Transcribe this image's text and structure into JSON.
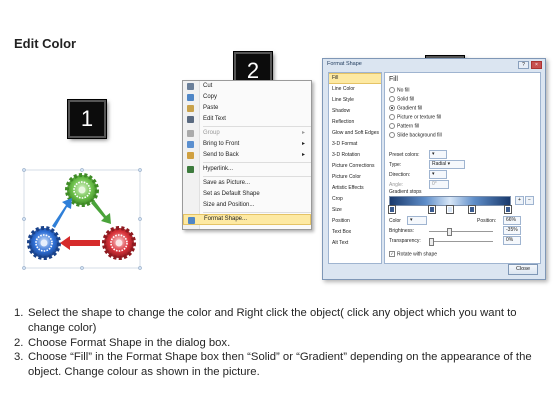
{
  "title": "Edit Color",
  "badges": [
    "1",
    "2",
    "3"
  ],
  "context_menu": {
    "items": [
      {
        "label": "Cut",
        "icon": "scissors-icon",
        "disabled": false,
        "submenu": false
      },
      {
        "label": "Copy",
        "icon": "copy-icon",
        "disabled": false,
        "submenu": false
      },
      {
        "label": "Paste",
        "icon": "paste-icon",
        "disabled": false,
        "submenu": false
      },
      {
        "label": "Edit Text",
        "icon": "edit-text-icon",
        "disabled": false,
        "submenu": false
      },
      {
        "label": "Group",
        "icon": "group-icon",
        "disabled": true,
        "submenu": true
      },
      {
        "label": "Bring to Front",
        "icon": "bring-front-icon",
        "disabled": false,
        "submenu": true
      },
      {
        "label": "Send to Back",
        "icon": "send-back-icon",
        "disabled": false,
        "submenu": true
      },
      {
        "label": "Hyperlink...",
        "icon": "hyperlink-icon",
        "disabled": false,
        "submenu": false
      },
      {
        "label": "Save as Picture...",
        "icon": "",
        "disabled": false,
        "submenu": false
      },
      {
        "label": "Set as Default Shape",
        "icon": "",
        "disabled": false,
        "submenu": false
      },
      {
        "label": "Size and Position...",
        "icon": "",
        "disabled": false,
        "submenu": false
      },
      {
        "label": "Format Shape...",
        "icon": "format-shape-icon",
        "disabled": false,
        "submenu": false,
        "highlighted": true
      }
    ]
  },
  "format_dialog": {
    "title": "Format Shape",
    "categories": [
      "Fill",
      "Line Color",
      "Line Style",
      "Shadow",
      "Reflection",
      "Glow and Soft Edges",
      "3-D Format",
      "3-D Rotation",
      "Picture Corrections",
      "Picture Color",
      "Artistic Effects",
      "Crop",
      "Size",
      "Position",
      "Text Box",
      "Alt Text"
    ],
    "selected_category": "Fill",
    "pane_heading": "Fill",
    "fill_options": [
      "No fill",
      "Solid fill",
      "Gradient fill",
      "Picture or texture fill",
      "Pattern fill",
      "Slide background fill"
    ],
    "selected_fill": "Gradient fill",
    "preset_colors_label": "Preset colors:",
    "type_label": "Type:",
    "type_value": "Radial",
    "direction_label": "Direction:",
    "angle_label": "Angle:",
    "angle_value": "0°",
    "gradient_stops_label": "Gradient stops",
    "color_label": "Color",
    "position_label": "Position:",
    "position_value": "66%",
    "brightness_label": "Brightness:",
    "brightness_value": "-35%",
    "transparency_label": "Transparency:",
    "transparency_value": "0%",
    "rotate_label": "Rotate with shape",
    "close_label": "Close"
  },
  "steps": [
    {
      "num": "1.",
      "text": "Select the shape to change the color and Right click the object( click any object which you want to change color)"
    },
    {
      "num": "2.",
      "text": "Choose Format Shape in the dialog box."
    },
    {
      "num": "3.",
      "text": "Choose “Fill” in the Format Shape box then “Solid” or “Gradient” depending on the appearance of the object. Change colour as shown in the picture."
    }
  ],
  "colors": {
    "gear_green": "#6cc04a",
    "gear_blue": "#2e6fd6",
    "gear_red": "#d9323a",
    "arrow_blue": "#2f7fd8",
    "arrow_green": "#4aa33a",
    "arrow_red": "#d62b2b",
    "highlight": "#fde9a2"
  }
}
